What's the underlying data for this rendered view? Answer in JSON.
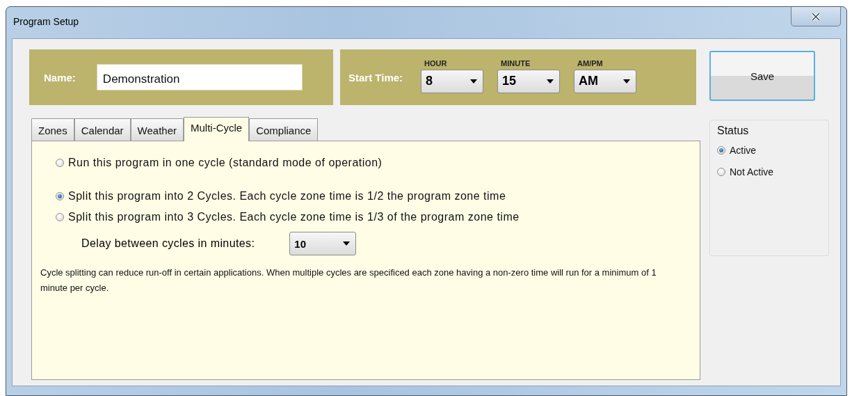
{
  "window": {
    "title": "Program Setup"
  },
  "name_field": {
    "label": "Name:",
    "value": "Demonstration"
  },
  "start_time": {
    "label": "Start Time:",
    "fields": [
      {
        "label": "HOUR",
        "value": "8"
      },
      {
        "label": "MINUTE",
        "value": "15"
      },
      {
        "label": "AM/PM",
        "value": "AM"
      }
    ]
  },
  "save_button": "Save",
  "tabs": [
    {
      "label": "Zones",
      "selected": false
    },
    {
      "label": "Calendar",
      "selected": false
    },
    {
      "label": "Weather",
      "selected": false
    },
    {
      "label": "Multi-Cycle",
      "selected": true
    },
    {
      "label": "Compliance",
      "selected": false
    }
  ],
  "multi_cycle": {
    "options": [
      {
        "label": "Run this program in one cycle (standard mode of operation)",
        "selected": false
      },
      {
        "label": "Split this program into 2 Cycles. Each cycle zone time is 1/2 the program zone time",
        "selected": true
      },
      {
        "label": "Split this program into 3 Cycles. Each cycle zone time is 1/3 of the program zone time",
        "selected": false
      }
    ],
    "delay": {
      "label": "Delay between cycles in minutes:",
      "value": "10"
    },
    "note": "Cycle splitting can reduce run-off in certain applications.  When multiple cycles are specificed each zone having a non-zero time will run for a minimum of 1 minute per cycle."
  },
  "status": {
    "title": "Status",
    "options": [
      {
        "label": "Active",
        "selected": true
      },
      {
        "label": "Not Active",
        "selected": false
      }
    ]
  }
}
